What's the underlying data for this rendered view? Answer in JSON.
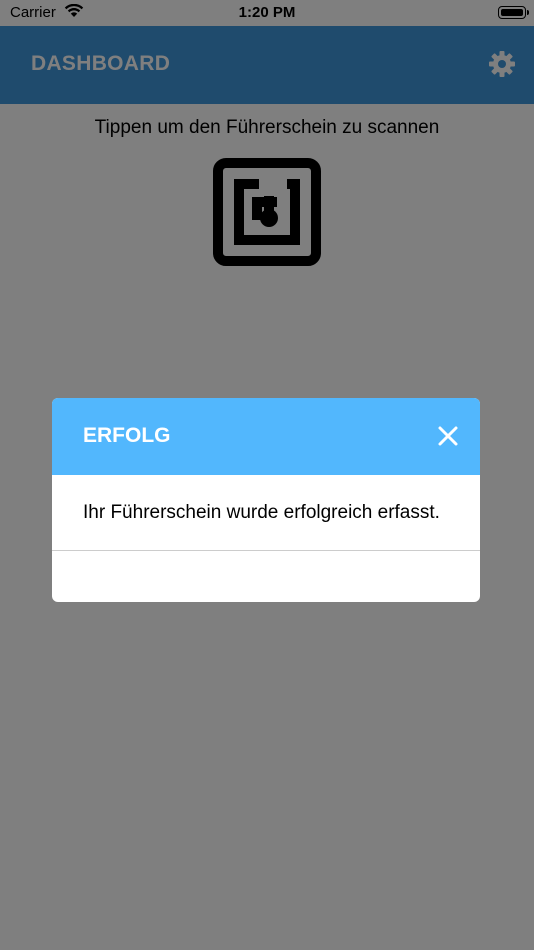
{
  "status_bar": {
    "carrier": "Carrier",
    "time": "1:20 PM",
    "wifi_icon": "wifi-icon",
    "battery_icon": "battery-icon"
  },
  "app_bar": {
    "title": "DASHBOARD",
    "settings_icon": "gear-icon",
    "color": "#3f96db"
  },
  "main": {
    "instruction": "Tippen um den Führerschein zu scannen",
    "nfc_icon": "nfc-icon"
  },
  "dialog": {
    "title": "ERFOLG",
    "close_icon": "close-icon",
    "message": "Ihr Führerschein wurde erfolgreich erfasst.",
    "header_color": "#52b7fd"
  }
}
